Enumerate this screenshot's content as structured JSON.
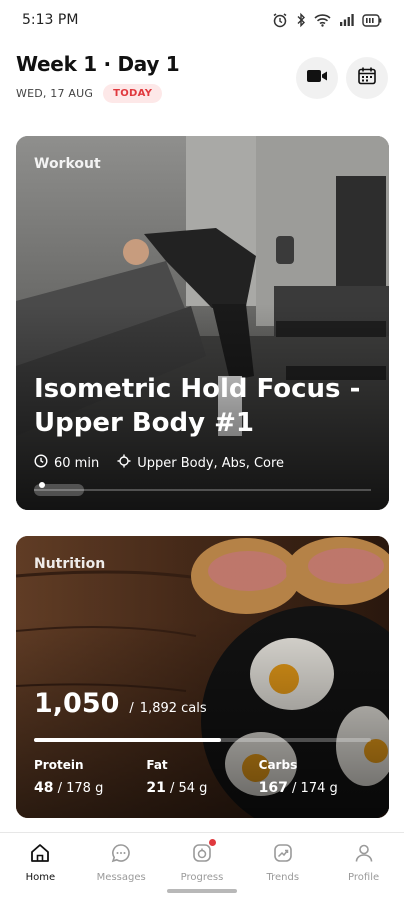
{
  "status": {
    "time": "5:13 PM",
    "icons": [
      "alarm-icon",
      "bluetooth-icon",
      "wifi-icon",
      "signal-icon",
      "battery-icon"
    ]
  },
  "header": {
    "title": "Week 1 · Day 1",
    "date": "WED, 17 AUG",
    "badge": "TODAY",
    "video_icon": "video-camera-icon",
    "calendar_icon": "calendar-icon"
  },
  "workout": {
    "label": "Workout",
    "title": "Isometric Hold Focus - Upper Body #1",
    "duration": "60 min",
    "focus": "Upper Body, Abs, Core",
    "carousel_index": 1
  },
  "nutrition": {
    "label": "Nutrition",
    "calories": "1,050",
    "calories_total": "1,892 cals",
    "calories_fraction": 0.555,
    "macros": [
      {
        "name": "Protein",
        "value": "48",
        "total": "178 g"
      },
      {
        "name": "Fat",
        "value": "21",
        "total": "54 g"
      },
      {
        "name": "Carbs",
        "value": "167",
        "total": "174 g"
      }
    ]
  },
  "nav": [
    {
      "label": "Home",
      "icon": "home-icon",
      "active": true
    },
    {
      "label": "Messages",
      "icon": "chat-icon",
      "active": false
    },
    {
      "label": "Progress",
      "icon": "progress-icon",
      "active": false,
      "badge": true
    },
    {
      "label": "Trends",
      "icon": "trends-icon",
      "active": false
    },
    {
      "label": "Profile",
      "icon": "profile-icon",
      "active": false
    }
  ],
  "colors": {
    "accent": "#e0393e",
    "badge_bg": "#fde8e8"
  }
}
